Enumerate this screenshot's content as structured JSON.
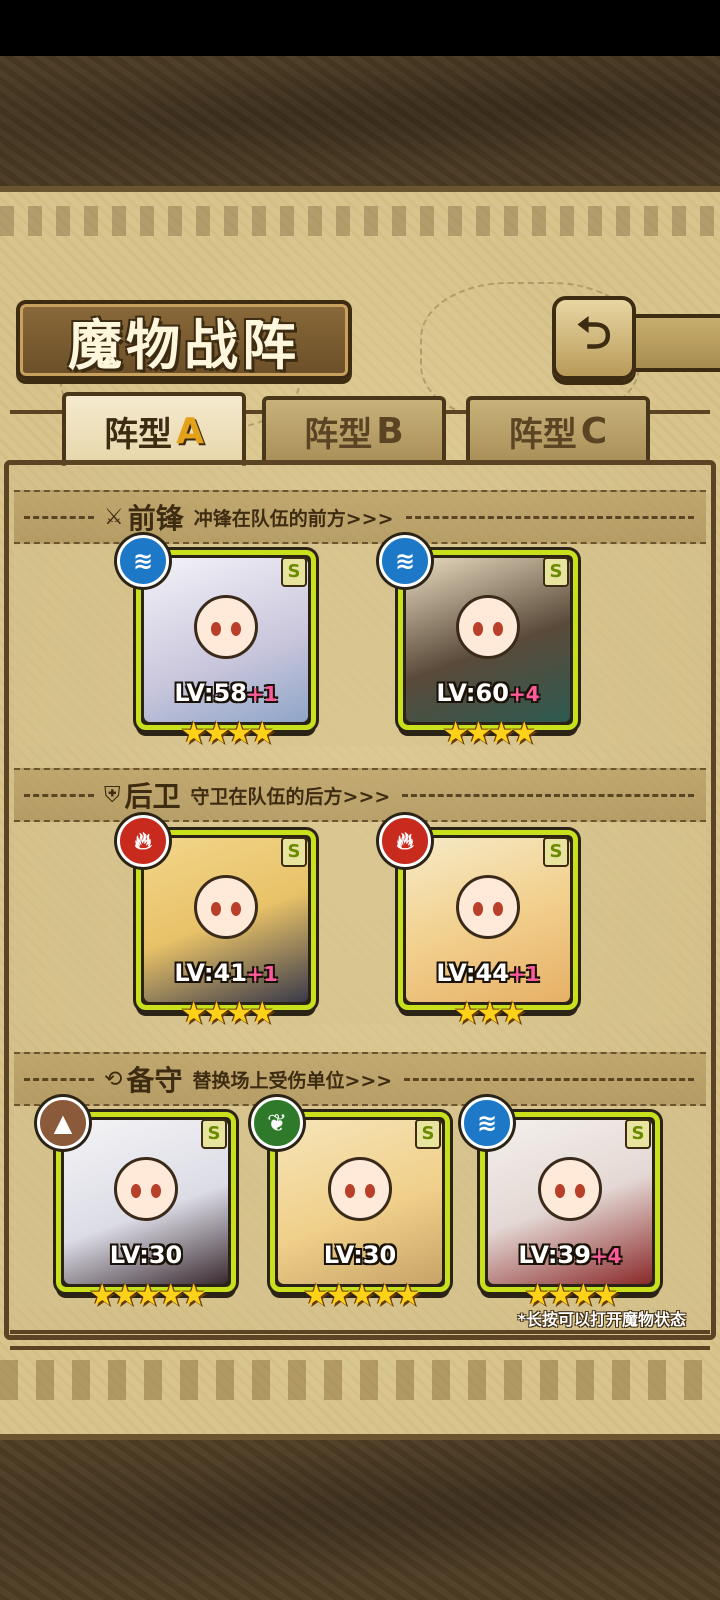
{
  "header": {
    "title": "魔物战阵",
    "back_icon": "return-arrow-icon"
  },
  "tabs": [
    {
      "label": "阵型",
      "letter": "A",
      "active": true
    },
    {
      "label": "阵型",
      "letter": "B",
      "active": false
    },
    {
      "label": "阵型",
      "letter": "C",
      "active": false
    }
  ],
  "sections": {
    "front": {
      "title": "前锋",
      "desc": "冲锋在队伍的前方>>>",
      "icon": "sword-icon"
    },
    "back": {
      "title": "后卫",
      "desc": "守卫在队伍的后方>>>",
      "icon": "shield-icon"
    },
    "reserve": {
      "title": "备守",
      "desc": "替换场上受伤单位>>>",
      "icon": "swap-icon"
    }
  },
  "cards": {
    "front1": {
      "rank": "S",
      "element": "water",
      "lv": "LV:58",
      "plus": "+1",
      "stars": "★★★★",
      "star_count": 4
    },
    "front2": {
      "rank": "S",
      "element": "water",
      "lv": "LV:60",
      "plus": "+4",
      "stars": "★★★★",
      "star_count": 4
    },
    "back1": {
      "rank": "S",
      "element": "fire",
      "lv": "LV:41",
      "plus": "+1",
      "stars": "★★★★",
      "star_count": 4
    },
    "back2": {
      "rank": "S",
      "element": "fire",
      "lv": "LV:44",
      "plus": "+1",
      "stars": "★★★",
      "star_count": 3
    },
    "reserve1": {
      "rank": "S",
      "element": "earth",
      "lv": "LV:30",
      "plus": "",
      "stars": "★★★★★",
      "star_count": 5
    },
    "reserve2": {
      "rank": "S",
      "element": "wood",
      "lv": "LV:30",
      "plus": "",
      "stars": "★★★★★",
      "star_count": 5
    },
    "reserve3": {
      "rank": "S",
      "element": "water",
      "lv": "LV:39",
      "plus": "+4",
      "stars": "★★★★",
      "star_count": 4
    }
  },
  "hint": "*长按可以打开魔物状态",
  "colors": {
    "water": "#1e78c8",
    "fire": "#c82a1e",
    "earth": "#8a5a3a",
    "wood": "#2e7a2a",
    "card_border": "#c9e01c",
    "accent": "#e3a21a"
  }
}
